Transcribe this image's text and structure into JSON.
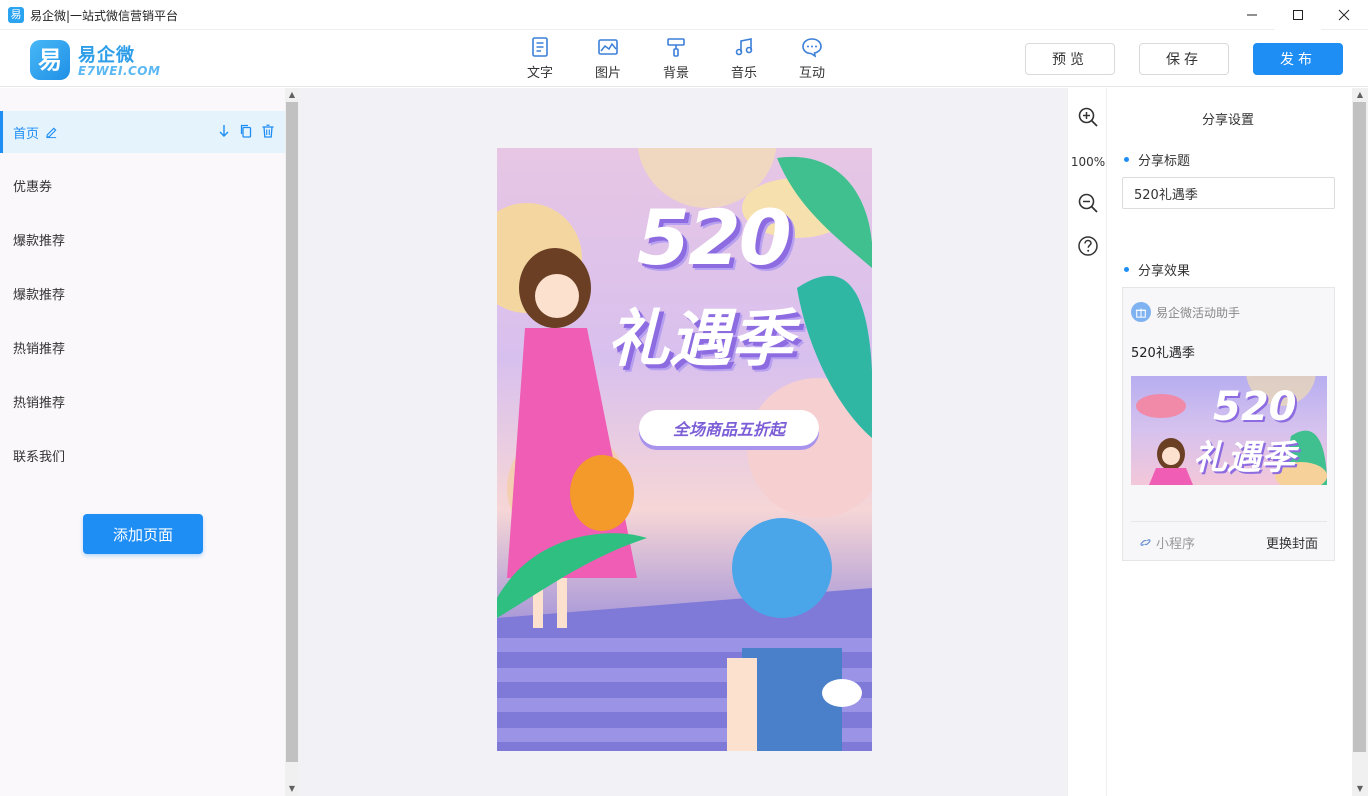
{
  "window": {
    "title": "易企微|一站式微信营销平台",
    "app_icon_char": "易"
  },
  "logo": {
    "mark": "易",
    "cn": "易企微",
    "en": "E7WEI.COM"
  },
  "tools": [
    {
      "label": "文字",
      "icon": "document-icon"
    },
    {
      "label": "图片",
      "icon": "image-icon"
    },
    {
      "label": "背景",
      "icon": "paint-roller-icon"
    },
    {
      "label": "音乐",
      "icon": "music-note-icon"
    },
    {
      "label": "互动",
      "icon": "chat-bubble-icon"
    }
  ],
  "actions": {
    "preview": "预览",
    "save": "保存",
    "publish": "发布"
  },
  "pages": [
    {
      "label": "首页",
      "active": true
    },
    {
      "label": "优惠券"
    },
    {
      "label": "爆款推荐"
    },
    {
      "label": "爆款推荐"
    },
    {
      "label": "热销推荐"
    },
    {
      "label": "热销推荐"
    },
    {
      "label": "联系我们"
    }
  ],
  "add_page_label": "添加页面",
  "poster": {
    "headline": "520",
    "subheadline": "礼遇季",
    "tagline": "全场商品五折起"
  },
  "zoom": {
    "value": "100%"
  },
  "share": {
    "panel_title": "分享设置",
    "title_label": "分享标题",
    "title_value": "520礼遇季",
    "effect_label": "分享效果",
    "card": {
      "account": "易企微活动助手",
      "title": "520礼遇季",
      "cover_t1": "520",
      "cover_t2": "礼遇季",
      "mini_label": "小程序",
      "change_cover": "更换封面"
    }
  },
  "colors": {
    "accent": "#1e8ef5",
    "sidebar_bg": "#fbf8fb",
    "canvas_bg": "#f2f2f6"
  }
}
